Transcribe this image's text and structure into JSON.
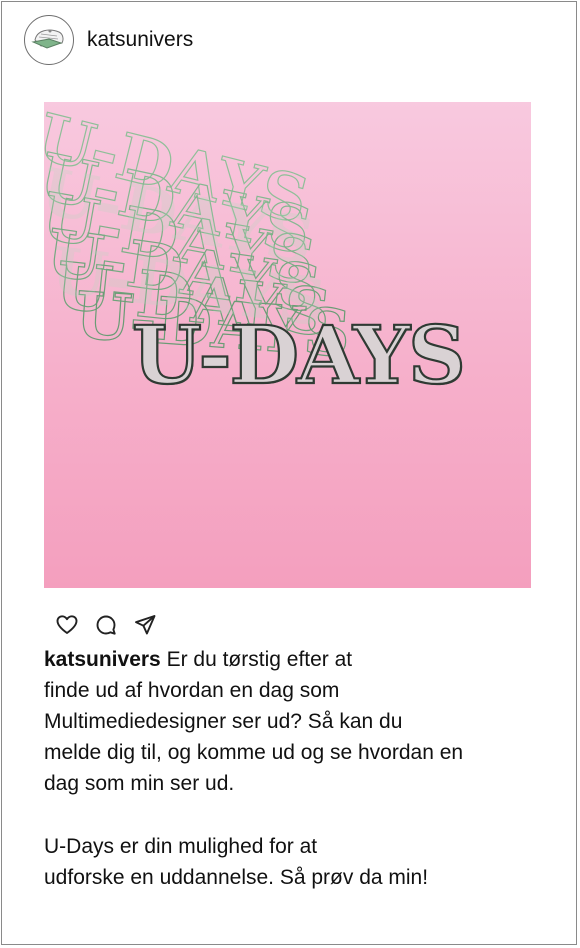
{
  "post": {
    "username": "katsunivers",
    "avatar_icon": "cap-icon",
    "image": {
      "ghost_text": "U-DAYS",
      "title": "U-DAYS",
      "background_top": "#f8c9df",
      "background_bottom": "#f49fbe",
      "accent_green": "#5f9a6e"
    },
    "actions": {
      "like_icon": "heart-icon",
      "comment_icon": "comment-icon",
      "share_icon": "send-icon"
    },
    "caption": {
      "username": "katsunivers",
      "line1": " Er du tørstig efter at",
      "line2": "finde ud af hvordan en dag som",
      "line3": "Multimediedesigner ser ud? Så kan du",
      "line4": "melde dig til, og komme ud og se hvordan en",
      "line5": "dag som min ser ud.",
      "line6": "U-Days er din mulighed for at",
      "line7": "udforske en uddannelse. Så prøv da min!"
    }
  }
}
